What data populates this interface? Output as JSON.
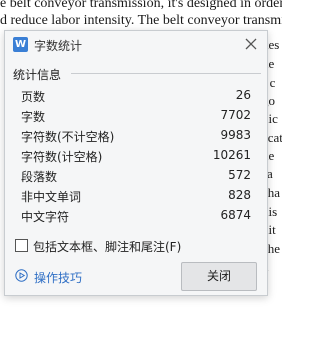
{
  "background_document": {
    "line1": "e belt conveyor transmission, it's designed in order to in",
    "line2": "d reduce labor intensity. The belt conveyor transmission",
    "right_fragments": [
      "kes",
      "he",
      "r c",
      "go",
      "nic",
      "ecat",
      "ne",
      "sa",
      "cha",
      "nis",
      "nit",
      "che",
      "n"
    ]
  },
  "dialog": {
    "title": "字数统计",
    "app_icon_letter": "W",
    "section_title": "统计信息",
    "stats": [
      {
        "label": "页数",
        "value": "26"
      },
      {
        "label": "字数",
        "value": "7702"
      },
      {
        "label": "字符数(不计空格)",
        "value": "9983"
      },
      {
        "label": "字符数(计空格)",
        "value": "10261"
      },
      {
        "label": "段落数",
        "value": "572"
      },
      {
        "label": "非中文单词",
        "value": "828"
      },
      {
        "label": "中文字符",
        "value": "6874"
      }
    ],
    "checkbox_label": "包括文本框、脚注和尾注(F)",
    "checkbox_checked": false,
    "tips_label": "操作技巧",
    "close_button_label": "关闭"
  },
  "colors": {
    "dialog_background": "#f5f6f7",
    "link": "#2f6fc5",
    "app_icon": "#3a7fd5",
    "button_background": "#e4e5e7"
  }
}
